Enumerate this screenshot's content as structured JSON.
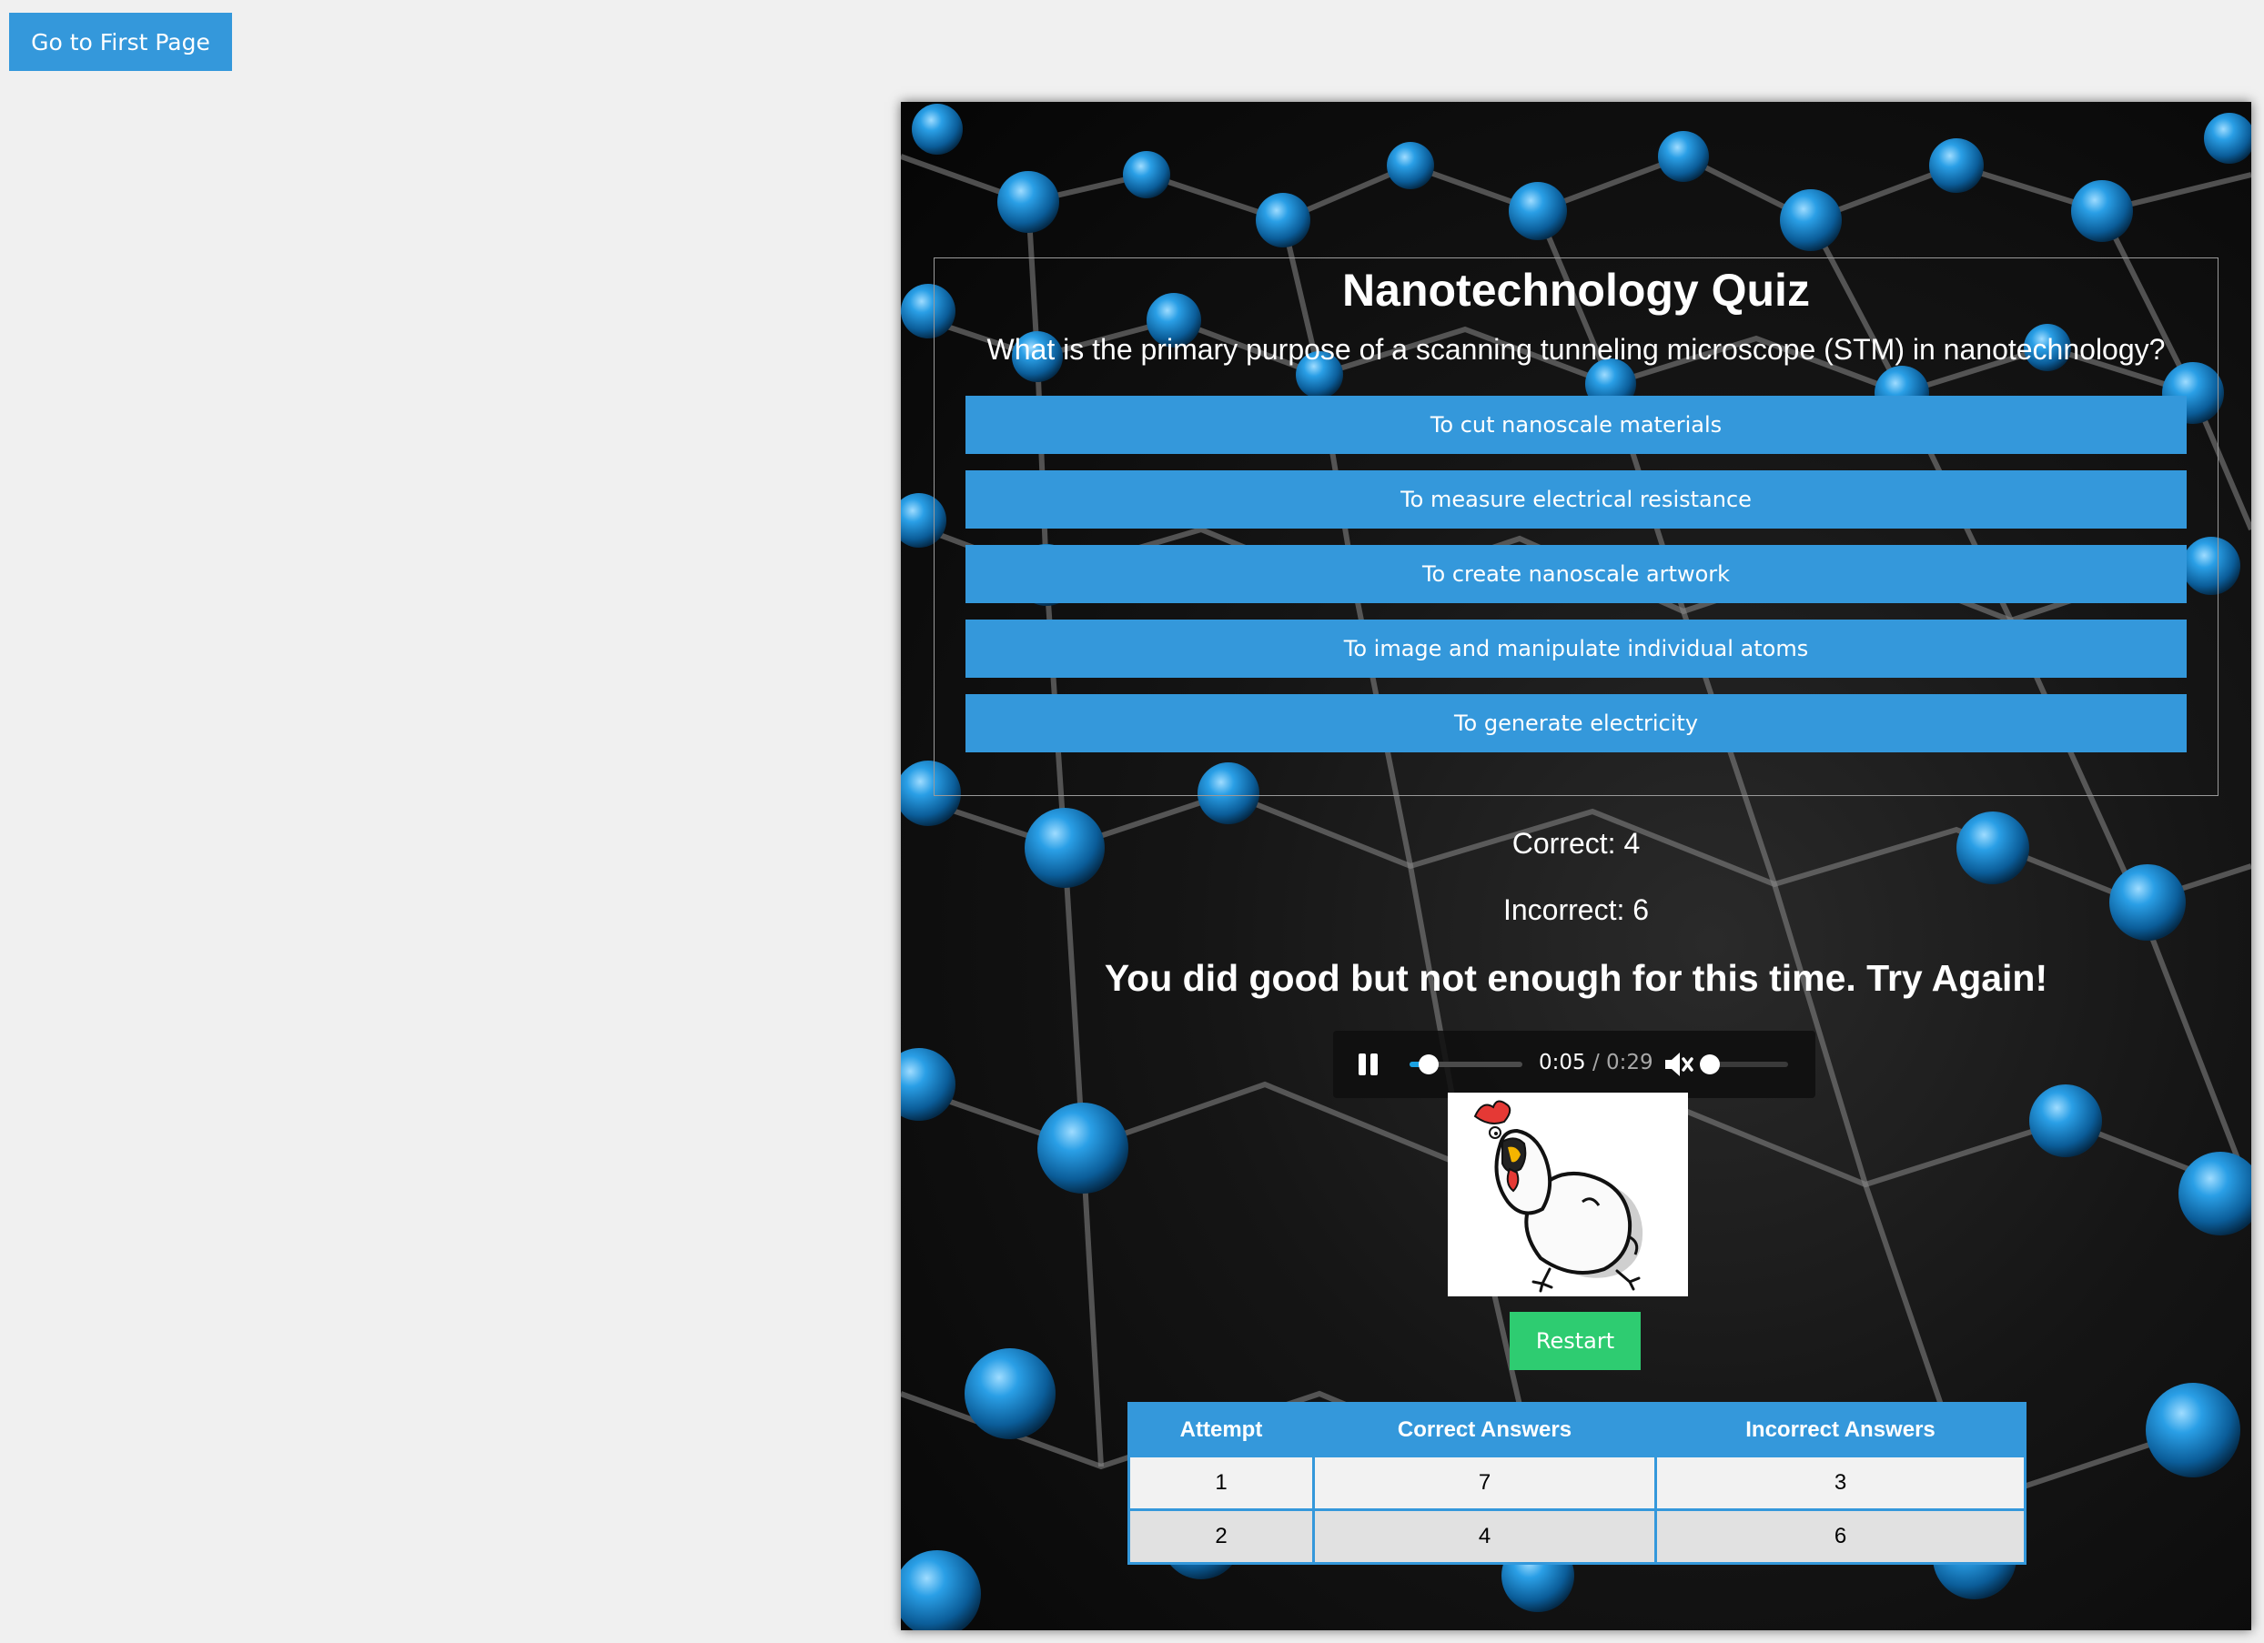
{
  "nav": {
    "first_page_label": "Go to First Page"
  },
  "quiz": {
    "title": "Nanotechnology Quiz",
    "question": "What is the primary purpose of a scanning tunneling microscope (STM) in nanotechnology?",
    "answers": [
      "To cut nanoscale materials",
      "To measure electrical resistance",
      "To create nanoscale artwork",
      "To image and manipulate individual atoms",
      "To generate electricity"
    ]
  },
  "score": {
    "correct_label": "Correct: 4",
    "incorrect_label": "Incorrect: 6",
    "message": "You did good but not enough for this time. Try Again!"
  },
  "audio": {
    "state": "playing",
    "current_time": "0:05",
    "separator": "/",
    "duration": "0:29",
    "progress_fraction": 0.17,
    "muted": true,
    "volume_fraction": 0.0
  },
  "restart_label": "Restart",
  "history": {
    "headers": [
      "Attempt",
      "Correct Answers",
      "Incorrect Answers"
    ],
    "rows": [
      [
        "1",
        "7",
        "3"
      ],
      [
        "2",
        "4",
        "6"
      ]
    ]
  },
  "colors": {
    "accent": "#3498db",
    "restart": "#2ecc71",
    "page_background": "#f0f0f0",
    "atom": "#1e8fd8"
  },
  "icons": {
    "play_pause": "pause-icon",
    "mute": "volume-muted-icon",
    "image": "screaming-chicken-cartoon"
  }
}
